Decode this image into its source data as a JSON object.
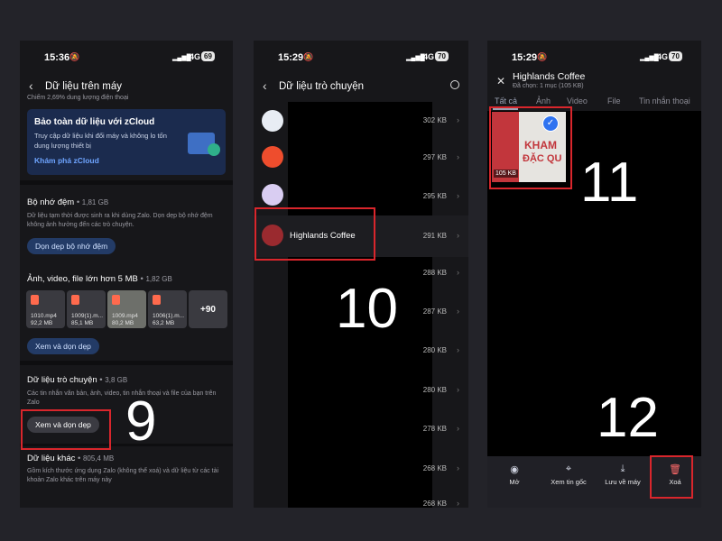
{
  "phone1": {
    "status": {
      "time": "15:36",
      "net": "4G",
      "battery": "69"
    },
    "header": {
      "title": "Dữ liệu trên máy"
    },
    "usage_note": "Chiếm 2,69% dung lượng điện thoại",
    "promo": {
      "title": "Bảo toàn dữ liệu với zCloud",
      "desc": "Truy cập dữ liệu khi đổi máy và không lo tốn dung lượng thiết bị",
      "link": "Khám phá zCloud"
    },
    "cache": {
      "title": "Bộ nhớ đệm",
      "size": "1,81 GB",
      "desc": "Dữ liệu tạm thời được sinh ra khi dùng Zalo. Dọn dẹp bộ nhớ đệm không ảnh hưởng đến các trò chuyện.",
      "button": "Dọn dẹp bộ nhớ đệm"
    },
    "media": {
      "title": "Ảnh, video, file lớn hơn 5 MB",
      "size": "1,82 GB",
      "thumbs": [
        {
          "name": "1010.mp4",
          "size": "92,2 MB"
        },
        {
          "name": "1009(1).m...",
          "size": "85,1 MB"
        },
        {
          "name": "1009.mp4",
          "size": "80,2 MB"
        },
        {
          "name": "1006(1).m...",
          "size": "63,2 MB"
        }
      ],
      "more": "+90",
      "button": "Xem và dọn dẹp"
    },
    "chat": {
      "title": "Dữ liệu trò chuyện",
      "size": "3,8 GB",
      "desc": "Các tin nhắn văn bản, ảnh, video, tin nhắn thoại và file của bạn trên Zalo",
      "button": "Xem và dọn dẹp"
    },
    "other": {
      "title": "Dữ liệu khác",
      "size": "805,4 MB",
      "desc": "Gồm kích thước ứng dụng Zalo (không thể xoá) và dữ liệu từ các tài khoản Zalo khác trên máy này"
    },
    "step": "9"
  },
  "phone2": {
    "status": {
      "time": "15:29",
      "net": "4G",
      "battery": "70"
    },
    "header": {
      "title": "Dữ liệu trò chuyện"
    },
    "rows": [
      {
        "name": "",
        "size": "302 KB"
      },
      {
        "name": "",
        "size": "297 KB"
      },
      {
        "name": "",
        "size": "295 KB"
      },
      {
        "name": "Highlands Coffee",
        "size": "291 KB"
      },
      {
        "name": "",
        "size": "288 KB"
      },
      {
        "name": "",
        "size": "287 KB"
      },
      {
        "name": "",
        "size": "280 KB"
      },
      {
        "name": "",
        "size": "280 KB"
      },
      {
        "name": "",
        "size": "278 KB"
      },
      {
        "name": "",
        "size": "268 KB"
      },
      {
        "name": "",
        "size": "268 KB"
      }
    ],
    "step": "10"
  },
  "phone3": {
    "status": {
      "time": "15:29",
      "net": "4G",
      "battery": "70"
    },
    "header": {
      "title": "Highlands Coffee",
      "subtitle": "Đã chọn: 1 mục (105 KB)"
    },
    "tabs": [
      "Tất cả",
      "Ảnh",
      "Video",
      "File",
      "Tin nhắn thoại"
    ],
    "selected_item": {
      "size": "105 KB",
      "line1": "KHAM",
      "line2": "ĐẶC QU"
    },
    "bottom_nav": [
      {
        "label": "Mở",
        "icon": "eye-icon"
      },
      {
        "label": "Xem tin gốc",
        "icon": "pin-icon"
      },
      {
        "label": "Lưu về máy",
        "icon": "download-icon"
      },
      {
        "label": "Xoá",
        "icon": "trash-icon"
      }
    ],
    "steps": [
      "11",
      "12"
    ]
  },
  "colors": {
    "accent": "#4a8cff",
    "highlight": "#d9262c",
    "background": "#232329"
  }
}
